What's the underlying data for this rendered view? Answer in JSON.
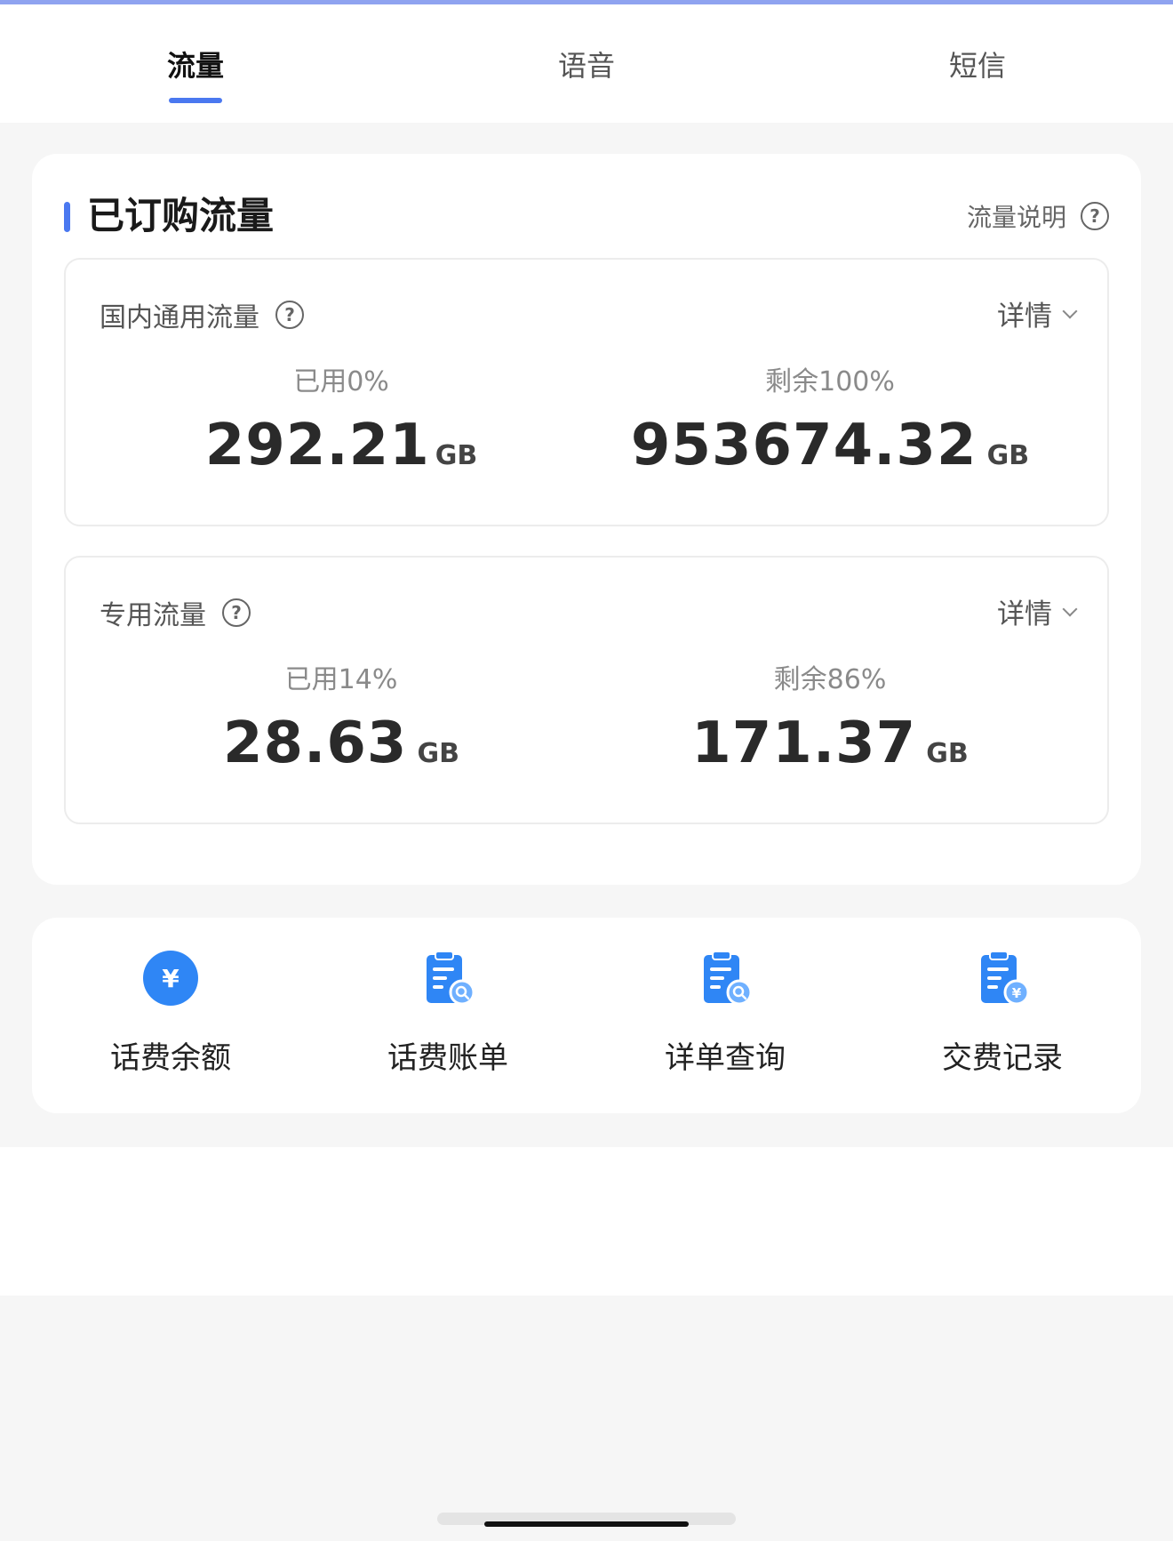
{
  "tabs": [
    {
      "label": "流量",
      "active": true
    },
    {
      "label": "语音",
      "active": false
    },
    {
      "label": "短信",
      "active": false
    }
  ],
  "section": {
    "title": "已订购流量",
    "help_link": "流量说明"
  },
  "packages": [
    {
      "name": "国内通用流量",
      "detail_label": "详情",
      "used_label": "已用0%",
      "used_value": "292.21",
      "used_unit": "GB",
      "remaining_label": "剩余100%",
      "remaining_value": "953674.32",
      "remaining_unit": "GB"
    },
    {
      "name": "专用流量",
      "detail_label": "详情",
      "used_label": "已用14%",
      "used_value": "28.63",
      "used_unit": "GB",
      "remaining_label": "剩余86%",
      "remaining_value": "171.37",
      "remaining_unit": "GB"
    }
  ],
  "shortcuts": [
    {
      "label": "话费余额",
      "icon": "yuan-circle-icon"
    },
    {
      "label": "话费账单",
      "icon": "bill-search-icon"
    },
    {
      "label": "详单查询",
      "icon": "detail-search-icon"
    },
    {
      "label": "交费记录",
      "icon": "payment-record-icon"
    }
  ],
  "colors": {
    "accent": "#4a78f0",
    "icon_blue": "#2f86f5",
    "background": "#f6f6f6"
  }
}
